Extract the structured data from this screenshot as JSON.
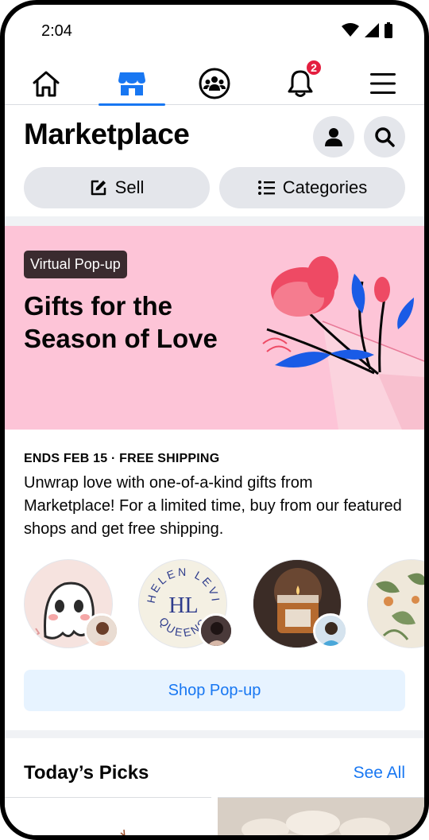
{
  "status_bar": {
    "time": "2:04"
  },
  "nav": {
    "items": [
      {
        "name": "home",
        "icon": "home-icon"
      },
      {
        "name": "marketplace",
        "icon": "marketplace-icon",
        "active": true
      },
      {
        "name": "groups",
        "icon": "groups-icon"
      },
      {
        "name": "notifications",
        "icon": "bell-icon",
        "badge": "2"
      },
      {
        "name": "menu",
        "icon": "menu-icon"
      }
    ]
  },
  "header": {
    "title": "Marketplace",
    "profile_icon": "person-icon",
    "search_icon": "search-icon"
  },
  "actions": {
    "sell_label": "Sell",
    "categories_label": "Categories"
  },
  "banner": {
    "tag": "Virtual Pop-up",
    "title": "Gifts for the Season of Love",
    "background": "#fdc4d7"
  },
  "promo": {
    "meta": "ENDS FEB 15 · FREE SHIPPING",
    "description": "Unwrap love with one-of-a-kind gifts from Marketplace! For a limited time, buy from our featured shops and get free shipping."
  },
  "shops": [
    {
      "type": "ghost-illustration"
    },
    {
      "type": "logo",
      "logo_text_top": "HELEN LEVI",
      "logo_text_bottom": "QUEENS",
      "monogram": "HL"
    },
    {
      "type": "candle-photo"
    },
    {
      "type": "floral-pattern"
    }
  ],
  "shop_button_label": "Shop Pop-up",
  "picks": {
    "title": "Today’s Picks",
    "see_all": "See All"
  },
  "colors": {
    "accent": "#1877f2",
    "badge": "#e41e3f",
    "pill": "#e4e6eb"
  }
}
